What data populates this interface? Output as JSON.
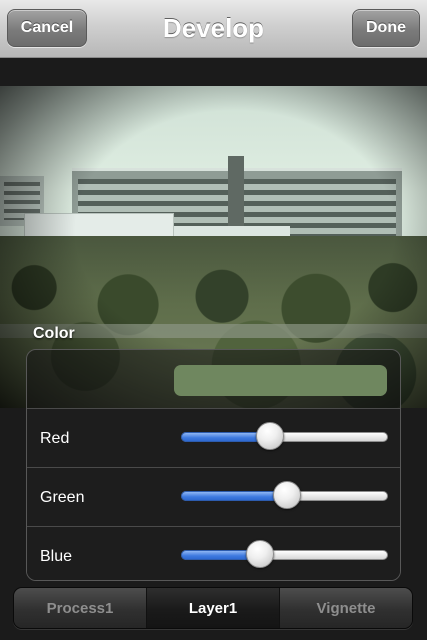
{
  "navbar": {
    "cancel_label": "Cancel",
    "title": "Develop",
    "done_label": "Done"
  },
  "color_panel": {
    "section_label": "Color",
    "swatch_color": "#6f875f",
    "sliders": [
      {
        "label": "Red",
        "value": 0.43
      },
      {
        "label": "Green",
        "value": 0.51
      },
      {
        "label": "Blue",
        "value": 0.38
      }
    ]
  },
  "tabs": [
    {
      "label": "Process1",
      "active": false
    },
    {
      "label": "Layer1",
      "active": true
    },
    {
      "label": "Vignette",
      "active": false
    }
  ],
  "colors": {
    "slider_fill": "#3e7ae0",
    "active_tab_text": "#ffffff",
    "inactive_tab_text": "#8e8e8e"
  }
}
